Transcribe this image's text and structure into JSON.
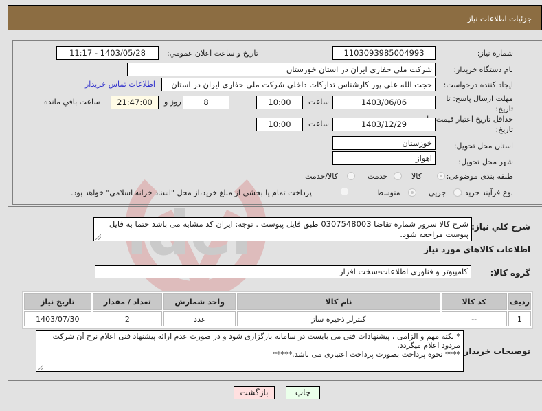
{
  "title": "جزئيات اطلاعات نياز",
  "form": {
    "need_number_label": "شماره نياز:",
    "need_number": "1103093985004993",
    "announce_label": "تاريخ و ساعت اعلان عمومي:",
    "announce_value": "1403/05/28 - 11:17",
    "buyer_org_label": "نام دستگاه خريدار:",
    "buyer_org": "شرکت ملی حفاری ایران در استان خوزستان",
    "creator_label": "ايجاد کننده درخواست:",
    "creator": "حجت الله علی پور کارشناس تدارکات داخلی شرکت ملی حفاری ایران در استان",
    "contact_link": "اطلاعات تماس خريدار",
    "reply_deadline_label_1": "مهلت ارسال پاسخ: تا",
    "reply_deadline_label_2": "تاريخ:",
    "reply_date": "1403/06/06",
    "hour_label": "ساعت",
    "reply_time": "10:00",
    "days_value": "8",
    "days_label": "روز و",
    "remaining_time": "21:47:00",
    "remaining_label": "ساعت باقي مانده",
    "price_validity_label_1": "حداقل تاريخ اعتبار قيمت: تا",
    "price_validity_label_2": "تاريخ:",
    "price_validity_date": "1403/12/29",
    "price_validity_time": "10:00",
    "province_label": "استان محل تحويل:",
    "province": "خوزستان",
    "city_label": "شهر محل تحويل:",
    "city": "اهواز",
    "category_label": "طبقه بندی موضوعی:",
    "category_options": [
      {
        "label": "کالا",
        "selected": true
      },
      {
        "label": "خدمت",
        "selected": false
      },
      {
        "label": "کالا/خدمت",
        "selected": false
      }
    ],
    "process_label": "نوع فرآيند خريد :",
    "process_options": [
      {
        "label": "جزيي",
        "selected": false
      },
      {
        "label": "متوسط",
        "selected": true
      }
    ],
    "treasury_checkbox_label": "پرداخت تمام يا بخشی از مبلغ خريد،از محل \"اسناد خزانه اسلامی\" خواهد بود.",
    "treasury_checked": false
  },
  "description": {
    "label": "شرح کلي نياز:",
    "text": "شرح کالا  سرور  شماره تقاضا  0307548003  طبق فایل پیوست . توجه: ایران کد مشابه می باشد حتما به فایل پیوست مراجعه شود."
  },
  "goods_section_title": "اطلاعات کالاهاي مورد نياز",
  "goods_group": {
    "label": "گروه کالا:",
    "value": "کامپیوتر و فناوری اطلاعات-سخت افزار"
  },
  "table": {
    "headers": [
      "رديف",
      "کد کالا",
      "نام کالا",
      "واحد شمارش",
      "تعداد / مقدار",
      "تاريخ نياز"
    ],
    "rows": [
      [
        "1",
        "--",
        "کنترلر ذخیره ساز",
        "عدد",
        "2",
        "1403/07/30"
      ]
    ]
  },
  "buyer_notes": {
    "label": "توضيحات خريدار:",
    "line1": "* نکته مهم و الزامی ، پیشنهادات فنی می بایست در سامانه بارگزاری شود و در صورت عدم ارائه پیشنهاد فنی اعلام نرخ آن شرکت مردود اعلام میگردد.",
    "line2": "****    نحوه پرداخت بصورت پرداخت اعتباری می باشد.*****"
  },
  "buttons": {
    "print": "چاپ",
    "back": "بازگشت"
  },
  "colors": {
    "title_bar": "#8c6d42",
    "print_button": "#eaffea",
    "back_button": "#ffe0e0",
    "link": "#3333cc"
  }
}
